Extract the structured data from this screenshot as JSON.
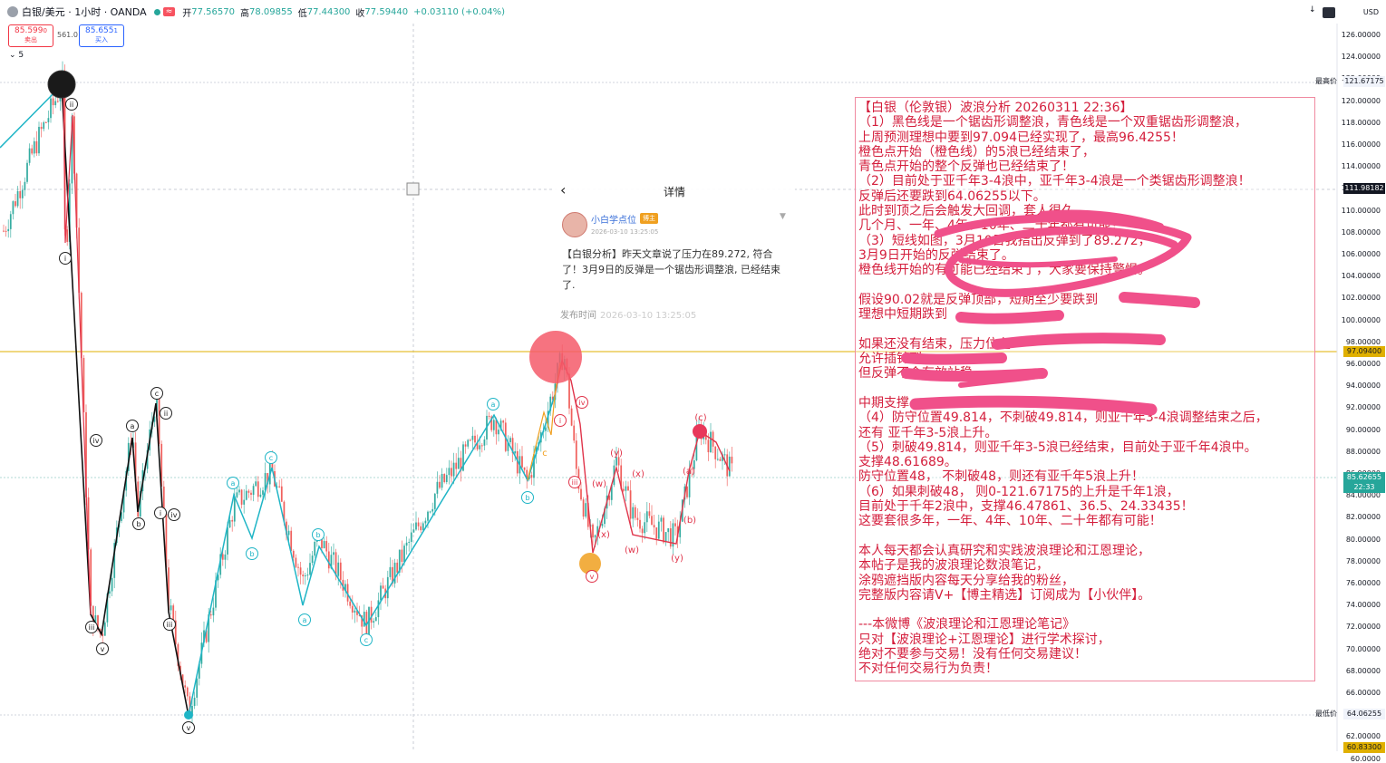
{
  "header": {
    "symbol": "白银/美元 · 1小时 · OANDA",
    "open_label": "开",
    "open": "77.56570",
    "high_label": "高",
    "high": "78.09855",
    "low_label": "低",
    "low": "77.44300",
    "close_label": "收",
    "close": "77.59440",
    "change": "+0.03110 (+0.04%)"
  },
  "trade": {
    "sell_price": "85.599",
    "sell_suffix": "0",
    "sell_label": "卖出",
    "spread": "561.0",
    "buy_price": "85.655",
    "buy_suffix": "1",
    "buy_label": "买入"
  },
  "indicator_count": "5",
  "toolbar": {
    "currency": "USD",
    "download_icon": "arrow-down-icon",
    "screen_icon": "screen-icon"
  },
  "price_axis": {
    "ticks": [
      "126.00000",
      "124.00000",
      "122.00000",
      "120.00000",
      "118.00000",
      "116.00000",
      "114.00000",
      "112.00000",
      "110.00000",
      "108.00000",
      "106.00000",
      "104.00000",
      "102.00000",
      "100.00000",
      "98.00000",
      "96.00000",
      "94.00000",
      "92.00000",
      "90.00000",
      "88.00000",
      "86.00000",
      "84.00000",
      "82.00000",
      "80.00000",
      "78.00000",
      "76.00000",
      "74.00000",
      "72.00000",
      "70.00000",
      "68.00000",
      "66.00000",
      "64.00000",
      "62.00000",
      "60.0000"
    ],
    "high_tag_label": "最高价",
    "high_tag": "121.67175",
    "cursor_tag": "111.98182",
    "level_tag": "97.09400",
    "current_tag": "85.62655",
    "current_timer": "22:33",
    "low_tag_label": "最低价",
    "low_tag": "64.06255",
    "bottom_tag": "60.83300"
  },
  "post": {
    "title": "详情",
    "author": "小白学点位",
    "badge": "博主",
    "date": "2026-03-10 13:25:05",
    "body": "【白银分析】昨天文章说了压力在89.272, 符合了！3月9日的反弹是一个锯齿形调整浪, 已经结束了.",
    "pub_label": "发布时间",
    "pub_time": "2026-03-10 13:25:05"
  },
  "note_lines": [
    "【白银（伦敦银）波浪分析 20260311 22:36】",
    "（1）黑色线是一个锯齿形调整浪，青色线是一个双重锯齿形调整浪，",
    "上周预测理想中要到97.094已经实现了，最高96.4255！",
    "橙色点开始（橙色线）的5浪已经结束了，",
    "青色点开始的整个反弹也已经结束了！",
    "（2）目前处于亚千年3-4浪中，亚千年3-4浪是一个类锯齿形调整浪！",
    "反弹后还要跌到64.06255以下。",
    "此时到顶之后会触发大回调，套人很久，",
    "几个月、一年、4年、10年、二十年都有可能！",
    "（3）短线如图，3月10日我指出反弹到了89.272，",
    "3月9日开始的反弹结束了。",
    "橙色线开始的有可能已经结束了，大家要保持警惕。",
    "",
    "假设90.02就是反弹顶部，短期至少要跌到",
    "理想中短期跌到",
    "",
    "如果还没有结束，压力位在",
    "允许插针到",
    "但反弹不会有效站稳",
    "",
    "中期支撑",
    "（4）防守位置49.814，不刺破49.814，则亚千年3-4浪调整结束之后，",
    "还有 亚千年3-5浪上升。",
    "（5）刺破49.814，则亚千年3-5浪已经结束，目前处于亚千年4浪中。",
    "支撑48.61689。",
    "防守位置48， 不刺破48，则还有亚千年5浪上升！",
    "（6）如果刺破48， 则0-121.67175的上升是千年1浪，",
    "目前处于千年2浪中，支撑46.47861、36.5、24.33435！",
    "这要套很多年，一年、4年、10年、二十年都有可能！",
    "",
    "本人每天都会认真研究和实践波浪理论和江恩理论，",
    "本帖子是我的波浪理论数浪笔记，",
    "涂鸦遮挡版内容每天分享给我的粉丝，",
    "完整版内容请V+【博主精选】订阅成为【小伙伴】。",
    "",
    "---本微博《波浪理论和江恩理论笔记》",
    "只对【波浪理论+江恩理论】进行学术探讨，",
    "绝对不要参与交易！没有任何交易建议！",
    "不对任何交易行为负责！"
  ],
  "wave_labels": [
    "ii",
    "i",
    "iv",
    "iii",
    "v",
    "a",
    "b",
    "c",
    "ii",
    "i",
    "iv",
    "iii",
    "v",
    "a",
    "b",
    "c",
    "a",
    "b",
    "c",
    "a",
    "b",
    "c",
    "iv",
    "iii",
    "i",
    "v",
    "(w)",
    "(x)",
    "(y)",
    "(w)",
    "(x)",
    "(y)",
    "(a)",
    "(b)",
    "(c)"
  ],
  "colors": {
    "up": "#26a69a",
    "down": "#ef5350",
    "cyan": "#1fb5c6",
    "black": "#111111",
    "red": "#e0344a",
    "orange": "#f0a020",
    "level": "#e0b000",
    "scribble": "#f0508a"
  },
  "chart_data": {
    "type": "candlestick",
    "title": "白银/美元 · 1小时 · OANDA",
    "y_axis_range": [
      60.833,
      126
    ],
    "horizontal_levels": [
      97.094,
      121.67175,
      64.06255
    ],
    "notable_prices": {
      "high": 121.67175,
      "low": 64.06255,
      "current": 85.62655
    }
  }
}
